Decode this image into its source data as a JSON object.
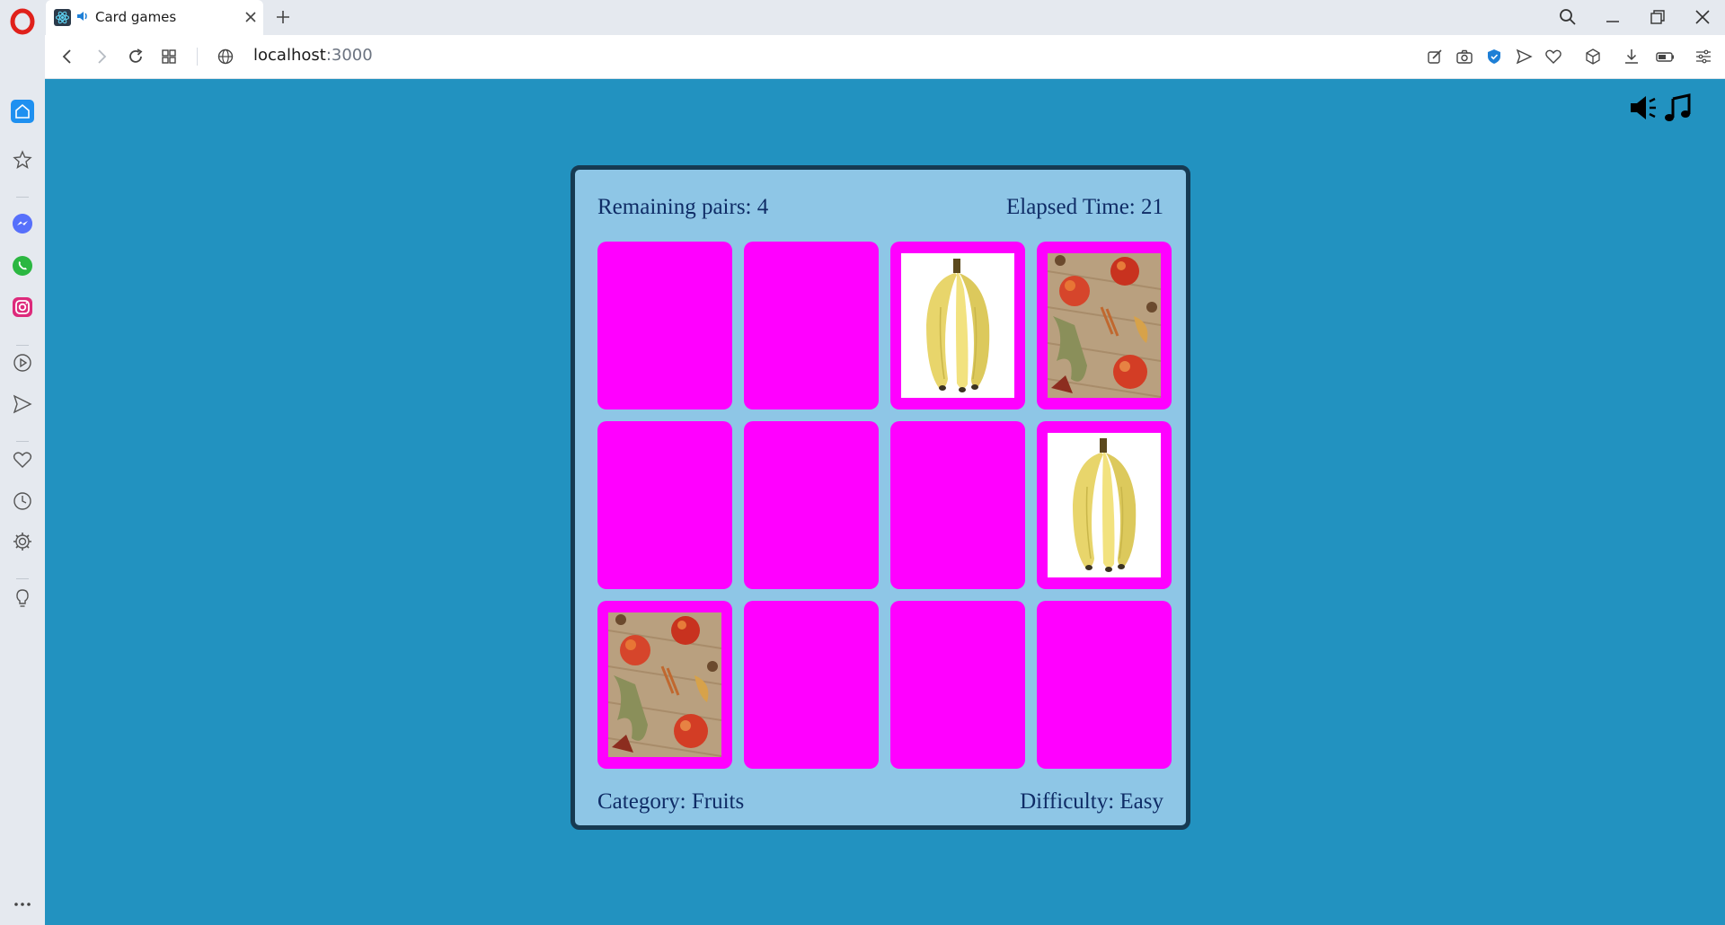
{
  "browser": {
    "tab": {
      "title": "Card games"
    },
    "address": {
      "host": "localhost",
      "port": ":3000"
    }
  },
  "game": {
    "remaining_pairs_label": "Remaining pairs: 4",
    "elapsed_time_label": "Elapsed Time: 21",
    "category_label": "Category: Fruits",
    "difficulty_label": "Difficulty: Easy",
    "card_back_color": "#ff00ff",
    "cards": [
      {
        "face": "hidden"
      },
      {
        "face": "hidden"
      },
      {
        "face": "banana"
      },
      {
        "face": "apple"
      },
      {
        "face": "hidden"
      },
      {
        "face": "hidden"
      },
      {
        "face": "hidden"
      },
      {
        "face": "banana"
      },
      {
        "face": "apple"
      },
      {
        "face": "hidden"
      },
      {
        "face": "hidden"
      },
      {
        "face": "hidden"
      }
    ]
  },
  "colors": {
    "page_background": "#2292c0",
    "board_background": "#8ec6e6",
    "board_border": "#163a52",
    "text": "#0f2c66"
  }
}
